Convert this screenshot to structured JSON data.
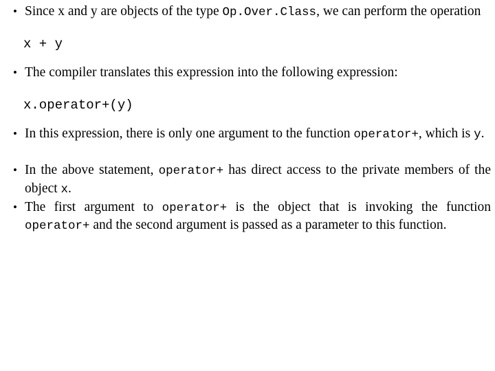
{
  "slide": {
    "bullets": [
      {
        "id": "bullet-1",
        "segments": [
          {
            "type": "text",
            "value": "Since x and y are objects of the type "
          },
          {
            "type": "code",
            "value": "Op.Over.Class"
          },
          {
            "type": "text",
            "value": ", we can perform the operation"
          }
        ],
        "plain": "Since x and y are objects of the type Op.Over.Class, we can perform the operation"
      },
      {
        "id": "bullet-2",
        "segments": [
          {
            "type": "text",
            "value": "The compiler translates this expression into the following expression:"
          }
        ],
        "plain": "The compiler translates this expression into the following expression:"
      },
      {
        "id": "bullet-3",
        "segments": [
          {
            "type": "text",
            "value": "In this expression, there is only one argument to the function "
          },
          {
            "type": "code",
            "value": "operator+"
          },
          {
            "type": "text",
            "value": ", which is "
          },
          {
            "type": "code",
            "value": "y"
          },
          {
            "type": "text",
            "value": "."
          }
        ],
        "plain": "In this expression, there is only one argument to the function operator+, which is y."
      },
      {
        "id": "bullet-4",
        "segments": [
          {
            "type": "text",
            "value": "In the above statement, "
          },
          {
            "type": "code",
            "value": "operator+"
          },
          {
            "type": "text",
            "value": " has direct access to the private members of the object "
          },
          {
            "type": "code",
            "value": "x"
          },
          {
            "type": "text",
            "value": "."
          }
        ],
        "plain": "In the above statement, operator+ has direct access to the private members of the object x."
      },
      {
        "id": "bullet-5",
        "segments": [
          {
            "type": "text",
            "value": "The first argument to "
          },
          {
            "type": "code",
            "value": "operator+"
          },
          {
            "type": "text",
            "value": " is the object that is invoking the function "
          },
          {
            "type": "code",
            "value": "operator+"
          },
          {
            "type": "text",
            "value": " and the second argument is passed as a parameter to this function."
          }
        ],
        "plain": "The first argument to operator+ is the object that is invoking the function operator+ and the second argument is passed as a parameter to this function."
      }
    ],
    "code_lines": [
      {
        "id": "code-expression",
        "value": "x + y"
      },
      {
        "id": "code-translated-expression",
        "value": "x.operator+(y)"
      }
    ],
    "bullet_glyph": "•",
    "text_color": "#000000",
    "background_color": "#ffffff"
  }
}
